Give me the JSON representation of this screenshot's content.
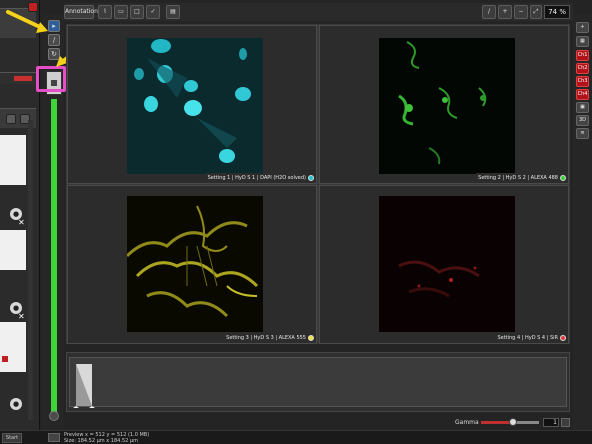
{
  "toolbar": {
    "annotations_label": "Annotations",
    "zoom_value": "74 %"
  },
  "panels": [
    {
      "label": "Setting 1 | HyD S 1 | DAPI (H2O solved)",
      "dot_color": "#19c7d6"
    },
    {
      "label": "Setting 2 | HyD S 2 | ALEXA 488",
      "dot_color": "#35d13a"
    },
    {
      "label": "Setting 3 | HyD S 3 | ALEXA 555",
      "dot_color": "#e8e23a"
    },
    {
      "label": "Setting 4 | HyD S 4 | SiR",
      "dot_color": "#e53a3a"
    }
  ],
  "gamma": {
    "label": "Gamma",
    "value": "1",
    "level_fraction": 0.55
  },
  "right_panel": {
    "channels": [
      "Ch1",
      "Ch2",
      "Ch3",
      "Ch4"
    ],
    "view_3d": "3D"
  },
  "status": {
    "start_label": "Start",
    "line1": "Preview    x = 512 y = 512  (1.0 MB)",
    "line2": "Size: 184.52 µm x 184.52 µm"
  },
  "colors": {
    "accent_green": "#3fd43a",
    "highlight_pink": "#e64ec8",
    "arrow_yellow": "#f5d21a"
  },
  "icons": [
    "pointer-icon",
    "pen-icon",
    "rotate-icon",
    "zoom-in-icon",
    "zoom-out-icon",
    "fit-icon",
    "checkmark-icon",
    "lock-icon",
    "trash-icon",
    "list-icon"
  ]
}
